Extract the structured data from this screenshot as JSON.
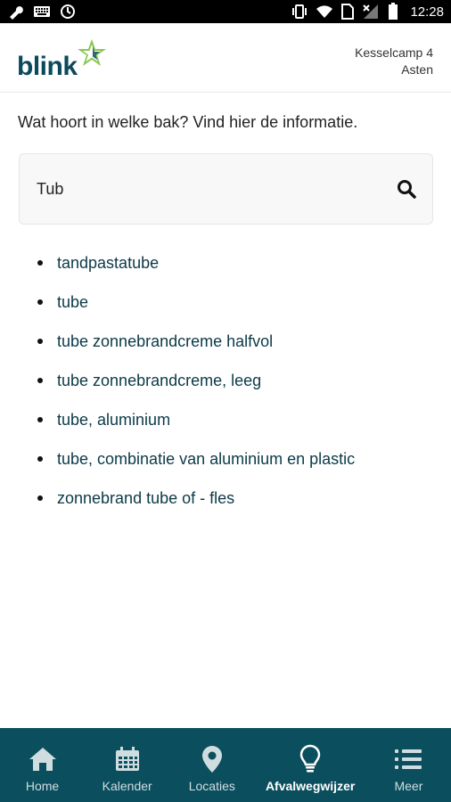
{
  "status_bar": {
    "time": "12:28",
    "icons": [
      "wrench-icon",
      "keyboard-icon",
      "sync-icon",
      "vibrate-icon",
      "wifi-icon",
      "sim-icon",
      "signal-icon",
      "battery-icon"
    ]
  },
  "header": {
    "logo_text": "blink",
    "address_line1": "Kesselcamp 4",
    "address_line2": "Asten"
  },
  "intro_text": "Wat hoort in welke bak? Vind hier de informatie.",
  "search": {
    "value": "Tub",
    "icon": "search-icon"
  },
  "results": [
    "tandpastatube",
    "tube",
    "tube zonnebrandcreme halfvol",
    "tube zonnebrandcreme, leeg",
    "tube, aluminium",
    "tube, combinatie van aluminium en plastic",
    "zonnebrand tube of - fles"
  ],
  "bottom_nav": {
    "items": [
      {
        "label": "Home",
        "icon": "home-icon",
        "active": false
      },
      {
        "label": "Kalender",
        "icon": "calendar-icon",
        "active": false
      },
      {
        "label": "Locaties",
        "icon": "location-pin-icon",
        "active": false
      },
      {
        "label": "Afvalwegwijzer",
        "icon": "lightbulb-icon",
        "active": true
      },
      {
        "label": "Meer",
        "icon": "menu-list-icon",
        "active": false
      }
    ]
  },
  "colors": {
    "brand_dark": "#0b4a5c",
    "nav_background": "#0b4f5e",
    "logo_star_green": "#7cc242"
  }
}
